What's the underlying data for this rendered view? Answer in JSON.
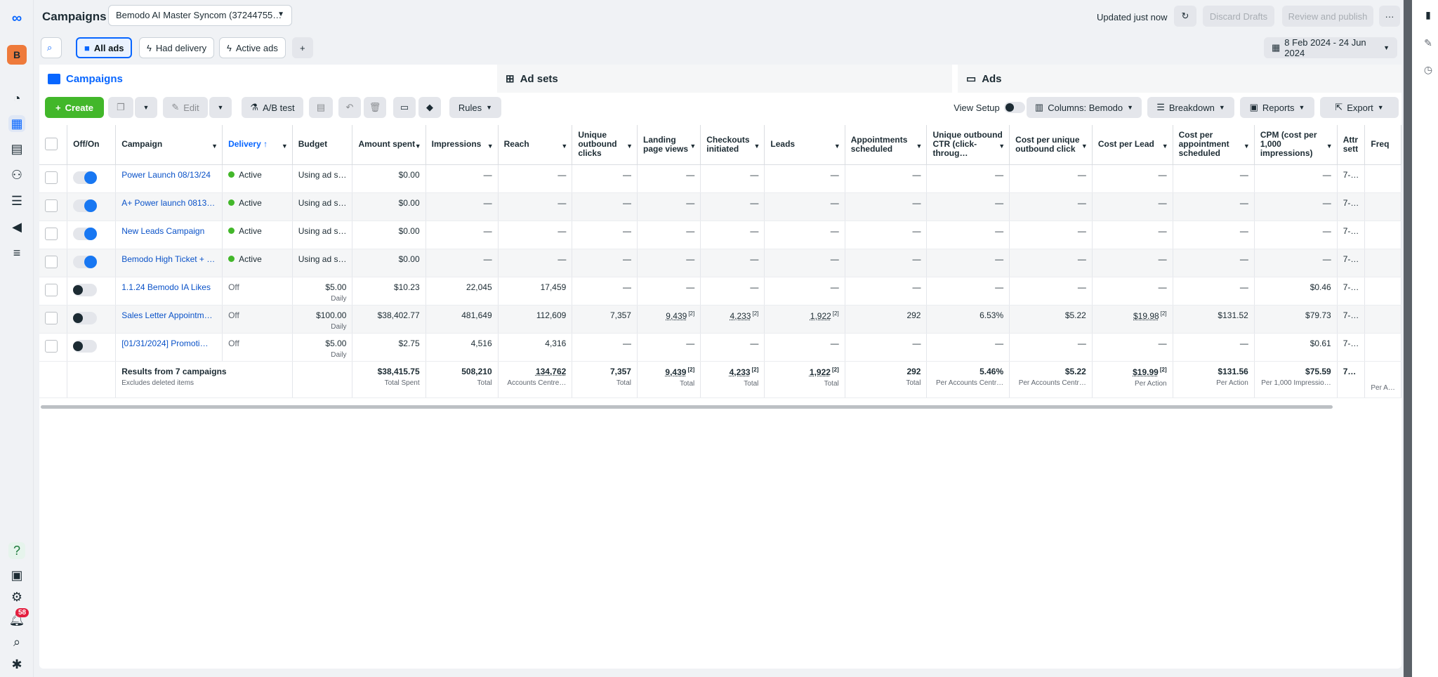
{
  "header": {
    "title": "Campaigns",
    "account": "Bemodo AI Master Syncom (37244755…",
    "updated": "Updated just now",
    "discard": "Discard Drafts",
    "review": "Review and publish",
    "more": "···"
  },
  "filters": {
    "all_ads": "All ads",
    "had_delivery": "Had delivery",
    "active_ads": "Active ads",
    "add": "+",
    "date_range": "8 Feb 2024 - 24 Jun 2024"
  },
  "tabs": {
    "campaigns": "Campaigns",
    "ad_sets": "Ad sets",
    "ads": "Ads"
  },
  "toolbar": {
    "create": "Create",
    "edit": "Edit",
    "ab_test": "A/B test",
    "rules": "Rules",
    "view_setup": "View Setup",
    "columns": "Columns: Bemodo",
    "breakdown": "Breakdown",
    "reports": "Reports",
    "export": "Export"
  },
  "notifications_count": "58",
  "table": {
    "headers": {
      "offon": "Off/On",
      "campaign": "Campaign",
      "delivery": "Delivery ↑",
      "budget": "Budget",
      "amount_spent": "Amount spent",
      "impressions": "Impressions",
      "reach": "Reach",
      "unique_outbound_clicks": "Unique outbound clicks",
      "landing_page_views": "Landing page views",
      "checkouts_initiated": "Checkouts initiated",
      "leads": "Leads",
      "appointments": "Appointments scheduled",
      "unique_ctr": "Unique outbound CTR (click-throug…",
      "cost_per_unique_click": "Cost per unique outbound click",
      "cost_per_lead": "Cost per Lead",
      "cost_per_appointment": "Cost per appointment scheduled",
      "cpm": "CPM (cost per 1,000 impressions)",
      "attribution": "Attr sett",
      "frequency": "Freq"
    },
    "rows": [
      {
        "on": true,
        "campaign": "Power Launch 08/13/24",
        "delivery": "Active",
        "budget": "Using ad s…",
        "budget_sub": "",
        "spent": "$0.00",
        "impressions": "—",
        "reach": "—",
        "uoc": "—",
        "lpv": "—",
        "checkouts": "—",
        "leads": "—",
        "appts": "—",
        "ctr": "—",
        "cpuc": "—",
        "cpl": "—",
        "cpa": "—",
        "cpm": "—",
        "attr": "7-…"
      },
      {
        "on": true,
        "campaign": "A+ Power launch 0813…",
        "delivery": "Active",
        "budget": "Using ad s…",
        "budget_sub": "",
        "spent": "$0.00",
        "impressions": "—",
        "reach": "—",
        "uoc": "—",
        "lpv": "—",
        "checkouts": "—",
        "leads": "—",
        "appts": "—",
        "ctr": "—",
        "cpuc": "—",
        "cpl": "—",
        "cpa": "—",
        "cpm": "—",
        "attr": "7-…"
      },
      {
        "on": true,
        "campaign": "New Leads Campaign",
        "delivery": "Active",
        "budget": "Using ad s…",
        "budget_sub": "",
        "spent": "$0.00",
        "impressions": "—",
        "reach": "—",
        "uoc": "—",
        "lpv": "—",
        "checkouts": "—",
        "leads": "—",
        "appts": "—",
        "ctr": "—",
        "cpuc": "—",
        "cpl": "—",
        "cpa": "—",
        "cpm": "—",
        "attr": "7-…"
      },
      {
        "on": true,
        "campaign": "Bemodo High Ticket + …",
        "delivery": "Active",
        "budget": "Using ad s…",
        "budget_sub": "",
        "spent": "$0.00",
        "impressions": "—",
        "reach": "—",
        "uoc": "—",
        "lpv": "—",
        "checkouts": "—",
        "leads": "—",
        "appts": "—",
        "ctr": "—",
        "cpuc": "—",
        "cpl": "—",
        "cpa": "—",
        "cpm": "—",
        "attr": "7-…"
      },
      {
        "on": false,
        "campaign": "1.1.24 Bemodo IA Likes",
        "delivery": "Off",
        "budget": "$5.00",
        "budget_sub": "Daily",
        "spent": "$10.23",
        "impressions": "22,045",
        "reach": "17,459",
        "uoc": "—",
        "lpv": "—",
        "checkouts": "—",
        "leads": "—",
        "appts": "—",
        "ctr": "—",
        "cpuc": "—",
        "cpl": "—",
        "cpa": "—",
        "cpm": "$0.46",
        "attr": "7-…"
      },
      {
        "on": false,
        "campaign": "Sales Letter Appointm…",
        "delivery": "Off",
        "budget": "$100.00",
        "budget_sub": "Daily",
        "spent": "$38,402.77",
        "impressions": "481,649",
        "reach": "112,609",
        "uoc": "7,357",
        "lpv": "9,439",
        "checkouts": "4,233",
        "leads": "1,922",
        "appts": "292",
        "ctr": "6.53%",
        "cpuc": "$5.22",
        "cpl": "$19.98",
        "cpa": "$131.52",
        "cpm": "$79.73",
        "attr": "7-…"
      },
      {
        "on": false,
        "campaign": "[01/31/2024] Promoti…",
        "delivery": "Off",
        "budget": "$5.00",
        "budget_sub": "Daily",
        "spent": "$2.75",
        "impressions": "4,516",
        "reach": "4,316",
        "uoc": "—",
        "lpv": "—",
        "checkouts": "—",
        "leads": "—",
        "appts": "—",
        "ctr": "—",
        "cpuc": "—",
        "cpl": "—",
        "cpa": "—",
        "cpm": "$0.61",
        "attr": "7-…"
      }
    ],
    "footnote": "[2]",
    "totals": {
      "label": "Results from 7 campaigns",
      "label_sub": "Excludes deleted items",
      "spent": "$38,415.75",
      "spent_sub": "Total Spent",
      "impressions": "508,210",
      "impressions_sub": "Total",
      "reach": "134,762",
      "reach_sub": "Accounts Centre…",
      "uoc": "7,357",
      "uoc_sub": "Total",
      "lpv": "9,439",
      "lpv_sub": "Total",
      "checkouts": "4,233",
      "checkouts_sub": "Total",
      "leads": "1,922",
      "leads_sub": "Total",
      "appts": "292",
      "appts_sub": "Total",
      "ctr": "5.46%",
      "ctr_sub": "Per Accounts Centr…",
      "cpuc": "$5.22",
      "cpuc_sub": "Per Accounts Centr…",
      "cpl": "$19.99",
      "cpl_sub": "Per Action",
      "cpa": "$131.56",
      "cpa_sub": "Per Action",
      "cpm": "$75.59",
      "cpm_sub": "Per 1,000 Impressio…",
      "attr": "7…",
      "freq_sub": "Per A…"
    }
  }
}
